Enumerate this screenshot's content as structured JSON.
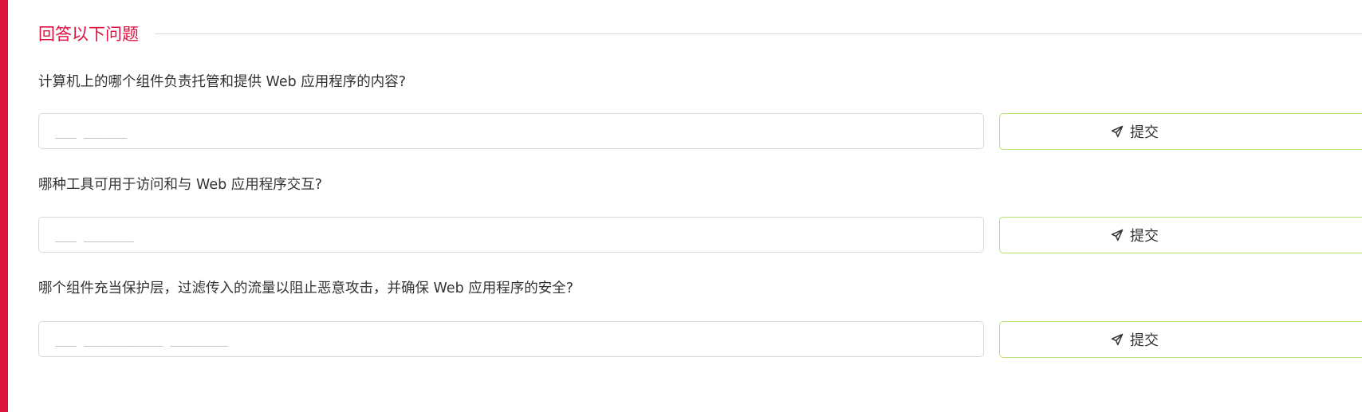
{
  "section": {
    "title": "回答以下问题"
  },
  "accent_color": "#dc143c",
  "button_border_color": "#b6e36a",
  "questions": [
    {
      "text": "计算机上的哪个组件负责托管和提供 Web 应用程序的内容?",
      "placeholder": "___ ______",
      "submit_label": "提交"
    },
    {
      "text": "哪种工具可用于访问和与 Web 应用程序交互?",
      "placeholder": "___ _______",
      "submit_label": "提交"
    },
    {
      "text": "哪个组件充当保护层，过滤传入的流量以阻止恶意攻击，并确保 Web 应用程序的安全?",
      "placeholder": "___ ___________ ________",
      "submit_label": "提交"
    }
  ],
  "icons": {
    "submit": "send-icon"
  }
}
